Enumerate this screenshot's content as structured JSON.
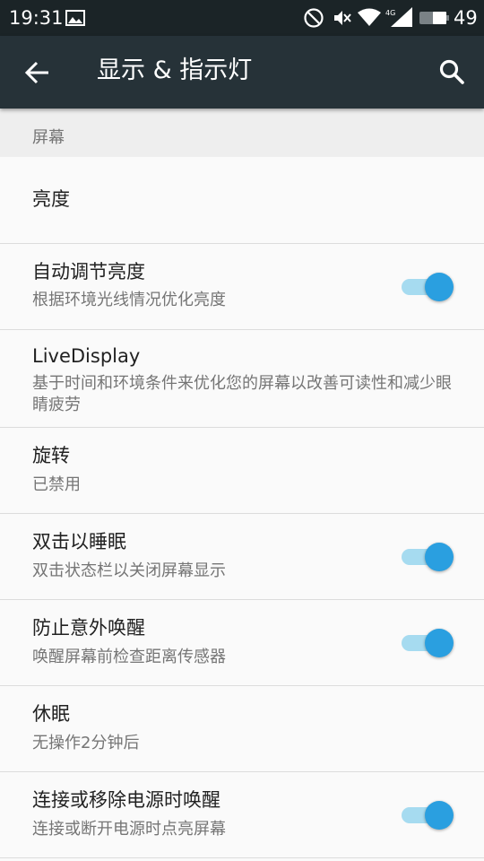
{
  "status_bar": {
    "time": "19:31",
    "battery_level": "49",
    "icons": [
      "image-notification-icon",
      "do-not-disturb-icon",
      "vibrate-off-icon",
      "wifi-icon",
      "signal-4g-icon",
      "battery-icon"
    ]
  },
  "toolbar": {
    "title": "显示 & 指示灯",
    "back_icon": "arrow-back-icon",
    "search_icon": "search-icon"
  },
  "section": {
    "label": "屏幕"
  },
  "preferences": [
    {
      "title": "亮度",
      "summary": ""
    },
    {
      "title": "自动调节亮度",
      "summary": "根据环境光线情况优化亮度",
      "switch_on": true
    },
    {
      "title": "LiveDisplay",
      "summary": "基于时间和环境条件来优化您的屏幕以改善可读性和减少眼睛疲劳"
    },
    {
      "title": "旋转",
      "summary": "已禁用"
    },
    {
      "title": "双击以睡眠",
      "summary": "双击状态栏以关闭屏幕显示",
      "switch_on": true
    },
    {
      "title": "防止意外唤醒",
      "summary": "唤醒屏幕前检查距离传感器",
      "switch_on": true
    },
    {
      "title": "休眠",
      "summary": "无操作2分钟后"
    },
    {
      "title": "连接或移除电源时唤醒",
      "summary": "连接或断开电源时点亮屏幕",
      "switch_on": true
    }
  ],
  "colors": {
    "status_bar": "#1b2427",
    "toolbar": "#263238",
    "switch_thumb": "#2a9fe0",
    "switch_track": "#a6dbf0"
  }
}
